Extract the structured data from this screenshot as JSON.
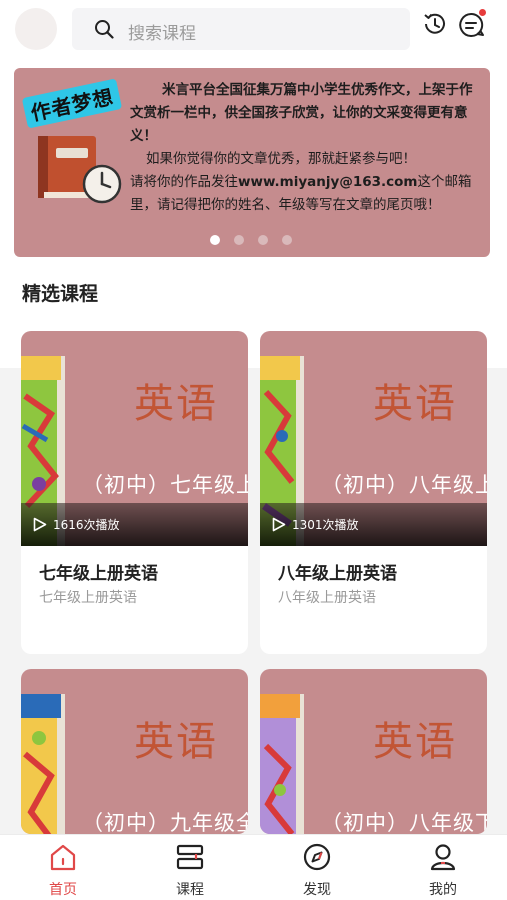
{
  "header": {
    "search_placeholder": "搜索课程"
  },
  "banner": {
    "tag": "作者梦想",
    "line1": "米言平台全国征集万篇中小学生优秀作文，上架于作文赏析一栏中，供全国孩子欣赏，让你的文采变得更有意义！",
    "line2": "如果你觉得你的文章优秀，那就赶紧参与吧！",
    "line3_pre": "请将你的作品发往",
    "email": "www.miyanjy@163.com",
    "line3_post": "这个邮箱里，请记得把你的姓名、年级等写在文章的尾页哦！",
    "slide_count": 4,
    "active_slide": 0
  },
  "section": {
    "title": "精选课程"
  },
  "courses": [
    {
      "subject": "英语",
      "grade": "（初中）七年级上",
      "plays": "1616次播放",
      "title": "七年级上册英语",
      "subtitle": "七年级上册英语"
    },
    {
      "subject": "英语",
      "grade": "（初中）八年级上",
      "plays": "1301次播放",
      "title": "八年级上册英语",
      "subtitle": "八年级上册英语"
    },
    {
      "subject": "英语",
      "grade": "（初中）九年级全",
      "plays": "",
      "title": "",
      "subtitle": ""
    },
    {
      "subject": "英语",
      "grade": "（初中）八年级下",
      "plays": "",
      "title": "",
      "subtitle": ""
    }
  ],
  "nav": {
    "items": [
      {
        "label": "首页",
        "icon": "home-icon",
        "active": true
      },
      {
        "label": "课程",
        "icon": "course-icon",
        "active": false
      },
      {
        "label": "发现",
        "icon": "compass-icon",
        "active": false
      },
      {
        "label": "我的",
        "icon": "profile-icon",
        "active": false
      }
    ]
  },
  "colors": {
    "accent": "#e04848",
    "banner_bg": "#c58c8e",
    "subject_text": "#c25535"
  }
}
